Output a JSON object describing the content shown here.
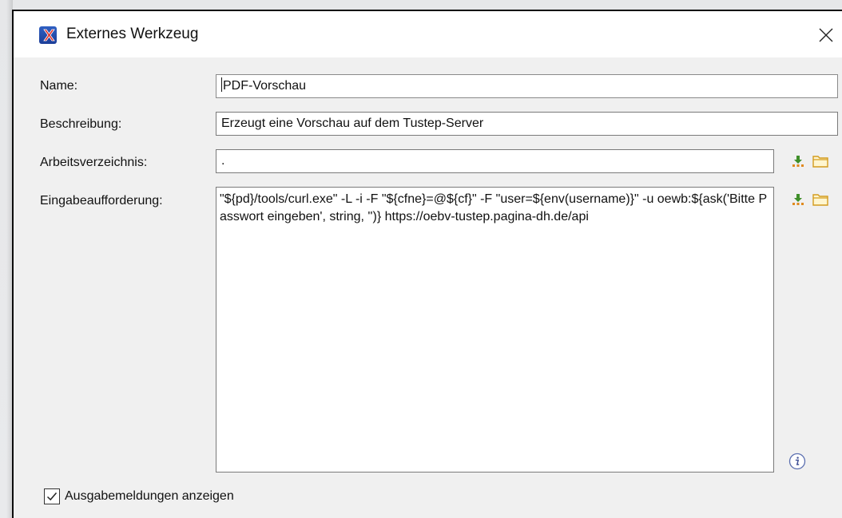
{
  "window": {
    "title": "Externes Werkzeug",
    "app_icon": "tustep-x-icon",
    "close_icon": "close-icon"
  },
  "form": {
    "name_label": "Name:",
    "name_value": "PDF-Vorschau",
    "description_label": "Beschreibung:",
    "description_value": "Erzeugt eine Vorschau auf dem Tustep-Server",
    "workdir_label": "Arbeitsverzeichnis:",
    "workdir_value": ".",
    "prompt_label": "Eingabeaufforderung:",
    "prompt_value": "\"${pd}/tools/curl.exe\" -L -i -F \"${cfne}=@${cf}\" -F \"user=${env(username)}\" -u oewb:${ask('Bitte Passwort eingeben', string, '')} https://oebv-tustep.pagina-dh.de/api",
    "insert_variable_icon": "insert-variable-icon",
    "browse_folder_icon": "folder-icon",
    "info_icon": "info-icon"
  },
  "options": {
    "show_output_label": "Ausgabemeldungen anzeigen",
    "show_output_checked": true
  },
  "colors": {
    "insert_icon_green": "#3f8f2a",
    "insert_icon_orange": "#e08a1e",
    "folder_yellow": "#e0b43a",
    "app_icon_blue": "#2f5fc2",
    "app_icon_red": "#e0322c"
  }
}
